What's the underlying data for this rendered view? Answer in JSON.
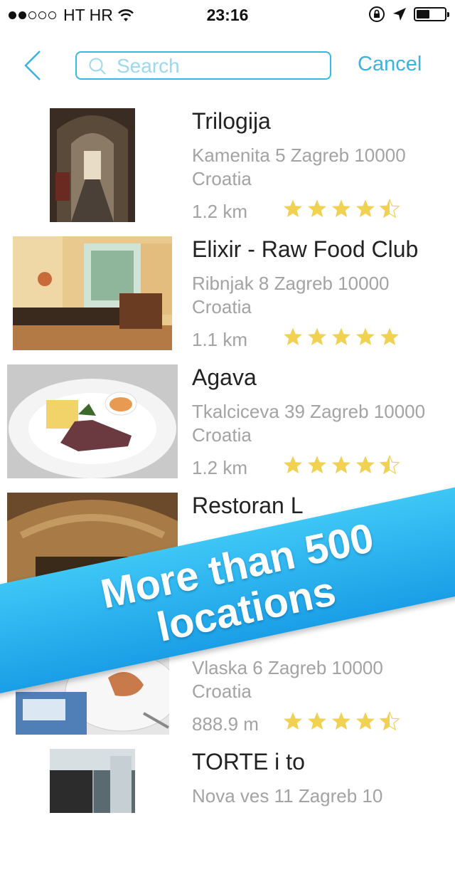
{
  "status_bar": {
    "carrier": "HT HR",
    "time": "23:16",
    "signal_full": 2,
    "signal_total": 5,
    "battery_level": 0.35
  },
  "nav": {
    "search_placeholder": "Search",
    "cancel_label": "Cancel",
    "accent_color": "#39b3df"
  },
  "locations": [
    {
      "name": "Trilogija",
      "address": "Kamenita 5 Zagreb 10000 Croatia",
      "distance": "1.2 km",
      "rating": 4.5
    },
    {
      "name": "Elixir - Raw Food Club",
      "address": "Ribnjak 8 Zagreb 10000 Croatia",
      "distance": "1.1 km",
      "rating": 5
    },
    {
      "name": "Agava",
      "address": "Tkalciceva 39 Zagreb 10000 Croatia",
      "distance": "1.2 km",
      "rating": 4.5
    },
    {
      "name": "Restoran L",
      "address": "",
      "distance": "",
      "rating": null
    },
    {
      "name": "",
      "address": "Vlaska 6 Zagreb 10000 Croatia",
      "distance": "888.9 m",
      "rating": 4.5
    },
    {
      "name": "TORTE i to",
      "address": "Nova ves 11 Zagreb 10",
      "distance": "",
      "rating": null
    }
  ],
  "banner": {
    "line1": "More than 500",
    "line2": "locations",
    "color": "#2bb3f0"
  },
  "star_color": "#f1d152"
}
